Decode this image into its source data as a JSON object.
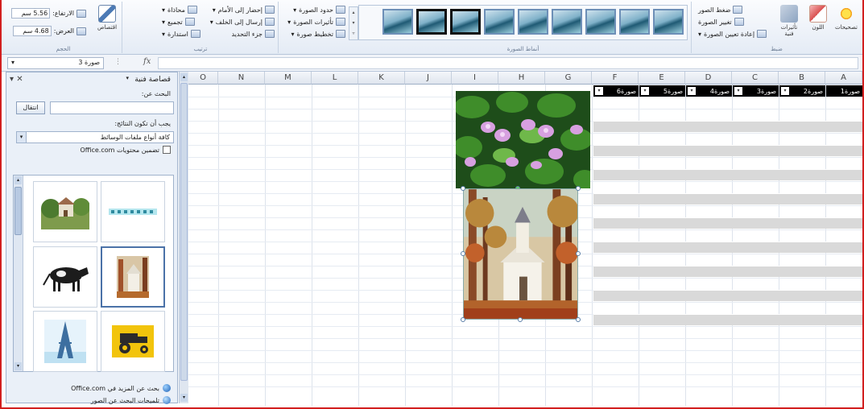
{
  "ribbon": {
    "size_group": {
      "label": "الحجم",
      "height_label": "الارتفاع:",
      "height_value": "5.56 سم",
      "width_label": "العرض:",
      "width_value": "4.68 سم",
      "crop_label": "اقتصاص"
    },
    "arrange_group": {
      "label": "ترتيب",
      "bring_forward": "إحضار إلى الأمام",
      "send_backward": "إرسال إلى الخلف",
      "selection_pane": "جزء التحديد",
      "align": "محاذاة",
      "group": "تجميع",
      "rotate": "استدارة"
    },
    "styles_group": {
      "label": "أنماط الصورة",
      "border": "حدود الصورة",
      "effects": "تأثيرات الصورة",
      "layout": "تخطيط صورة"
    },
    "adjust_group": {
      "label": "ضبط",
      "corrections": "تصحيحات",
      "color": "اللون",
      "artistic": "تأثيرات فنية",
      "compress": "ضغط الصور",
      "change": "تغيير الصورة",
      "reset": "إعادة تعيين الصورة"
    }
  },
  "formula_bar": {
    "name_box": "صورة 3",
    "fx": "fx"
  },
  "clip_pane": {
    "title": "قصاصة فنية",
    "search_label": "البحث عن:",
    "search_value": "",
    "go_button": "انتقال",
    "results_label": "يجب أن تكون النتائج:",
    "results_combo": "كافة أنواع ملفات الوسائط",
    "include_office": "تضمين محتويات Office.com",
    "more_link": "بحث عن المزيد في Office.com",
    "tips_link": "تلميحات البحث عن الصور",
    "clips": [
      {
        "name": "clip-house"
      },
      {
        "name": "clip-dots-line"
      },
      {
        "name": "clip-cow"
      },
      {
        "name": "clip-church"
      },
      {
        "name": "clip-eiffel"
      },
      {
        "name": "clip-tractor"
      }
    ]
  },
  "sheet": {
    "columns": [
      "O",
      "N",
      "M",
      "L",
      "K",
      "J",
      "I",
      "H",
      "G",
      "F",
      "E",
      "D",
      "C",
      "B",
      "A"
    ],
    "table_headers": [
      "صورة6",
      "صورة5",
      "صورة4",
      "صورة3",
      "صورة2",
      "صورة1"
    ]
  }
}
